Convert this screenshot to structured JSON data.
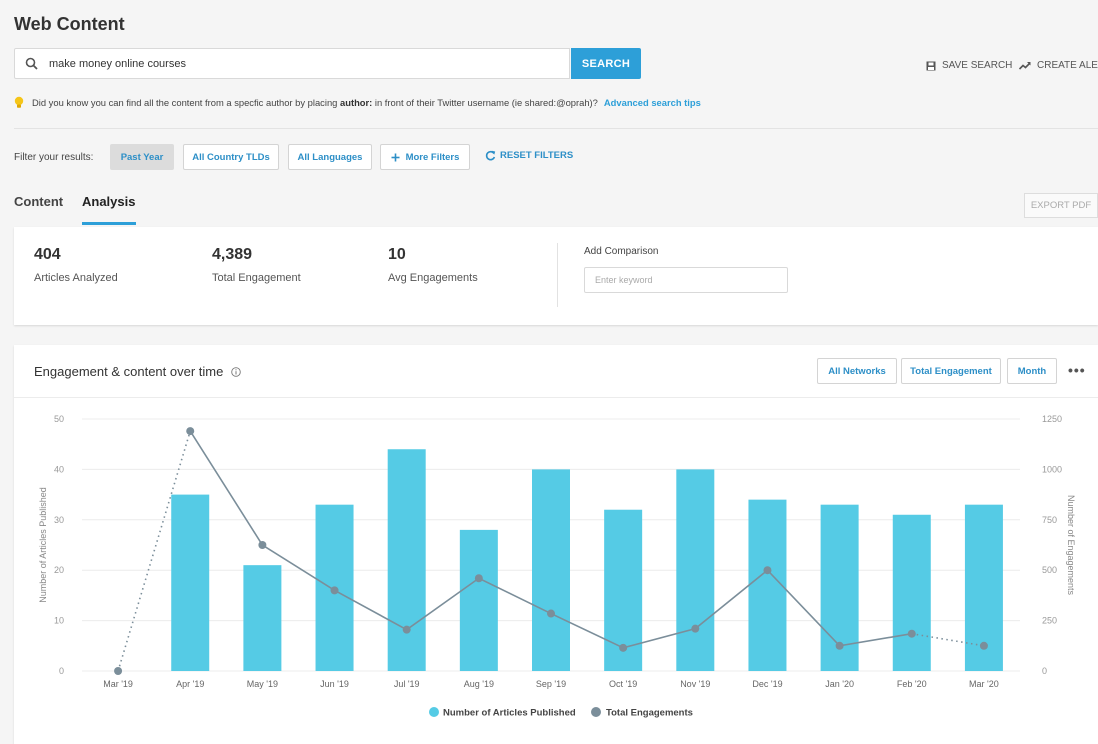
{
  "page": {
    "title": "Web Content"
  },
  "search": {
    "value": "make money online courses",
    "button": "SEARCH"
  },
  "actions": {
    "save_search": "SAVE SEARCH",
    "create_alert": "CREATE ALERT"
  },
  "tip": {
    "pre": "Did you know you can find all the content from a specfic author by placing",
    "keyword": "author:",
    "post": "in front of their Twitter username (ie shared:@oprah)?",
    "link": "Advanced search tips"
  },
  "filters": {
    "label": "Filter your results:",
    "buttons": [
      "Past Year",
      "All Country TLDs",
      "All Languages",
      "More Filters"
    ],
    "reset": "RESET FILTERS"
  },
  "tabs": [
    "Content",
    "Analysis"
  ],
  "export": "EXPORT PDF",
  "stats": [
    {
      "value": "404",
      "label": "Articles Analyzed"
    },
    {
      "value": "4,389",
      "label": "Total Engagement"
    },
    {
      "value": "10",
      "label": "Avg Engagements"
    }
  ],
  "comparison": {
    "label": "Add Comparison",
    "placeholder": "Enter keyword"
  },
  "chart_panel": {
    "title": "Engagement & content over time",
    "buttons": [
      "All Networks",
      "Total Engagement",
      "Month"
    ]
  },
  "colors": {
    "accent": "#2d9fd8",
    "bar": "#55cbe5",
    "line": "#7b8e9a"
  },
  "chart_data": {
    "type": "bar",
    "categories": [
      "Mar '19",
      "Apr '19",
      "May '19",
      "Jun '19",
      "Jul '19",
      "Aug '19",
      "Sep '19",
      "Oct '19",
      "Nov '19",
      "Dec '19",
      "Jan '20",
      "Feb '20",
      "Mar '20"
    ],
    "series": [
      {
        "name": "Number of Articles Published",
        "type": "bar",
        "axis": "left",
        "values": [
          0,
          35,
          21,
          33,
          44,
          28,
          40,
          32,
          40,
          34,
          33,
          31,
          33
        ]
      },
      {
        "name": "Total Engagements",
        "type": "line",
        "axis": "right",
        "values": [
          0,
          1190,
          625,
          400,
          205,
          460,
          285,
          115,
          210,
          500,
          125,
          185,
          125
        ]
      }
    ],
    "ylabel": "Number of Articles Published",
    "y2label": "Number of Engagements",
    "ylim": [
      0,
      50
    ],
    "y2lim": [
      0,
      1250
    ],
    "yticks": [
      "0",
      "10",
      "20",
      "30",
      "40",
      "50"
    ],
    "y2ticks": [
      "0",
      "250",
      "500",
      "750",
      "1000",
      "1250"
    ],
    "grid": true,
    "legend": "bottom"
  }
}
